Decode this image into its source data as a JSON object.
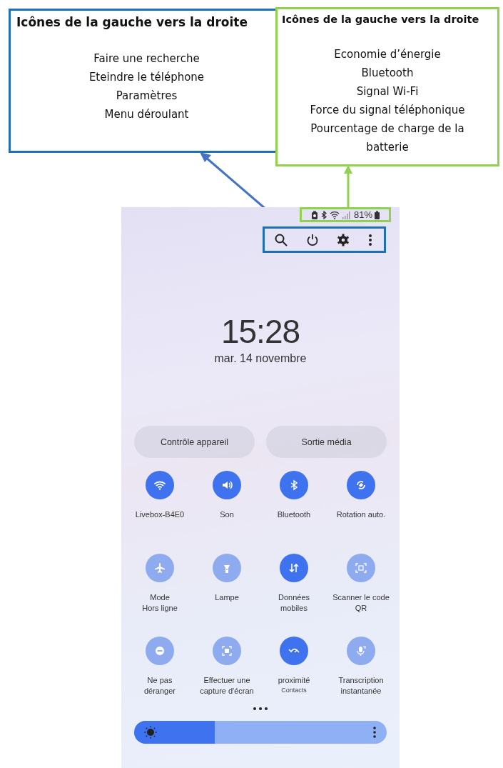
{
  "callouts": [
    {
      "title": "Icônes de la gauche vers la droite",
      "color": "#1f6fb5",
      "lines": [
        "Faire une recherche",
        "Eteindre le téléphone",
        "Paramètres",
        "Menu déroulant"
      ]
    },
    {
      "title": "Icônes de la gauche vers la droite",
      "color": "#92d050",
      "lines": [
        "Economie d’énergie",
        "Bluetooth",
        "Signal Wi-Fi",
        "Force du signal téléphonique",
        "Pourcentage de charge de la batterie"
      ]
    }
  ],
  "phone": {
    "status_bar": {
      "battery": "81%"
    },
    "clock": "15:28",
    "date": "mar. 14 novembre",
    "buttons": [
      "Contrôle appareil",
      "Sortie média"
    ],
    "tiles": [
      {
        "label": "Livebox-B4E0",
        "on": true
      },
      {
        "label": "Son",
        "on": true
      },
      {
        "label": "Bluetooth",
        "on": true
      },
      {
        "label": "Rotation auto.",
        "on": true
      },
      {
        "label": "Mode\nHors ligne",
        "on": false
      },
      {
        "label": "Lampe",
        "on": false
      },
      {
        "label": "Données\nmobiles",
        "on": true
      },
      {
        "label": "Scanner le code\nQR",
        "on": false
      },
      {
        "label": "Ne pas\ndéranger",
        "on": false
      },
      {
        "label": "Effectuer une\ncapture d'écran",
        "on": false
      },
      {
        "label": "proximité",
        "sublabel": "Contacts",
        "on": true
      },
      {
        "label": "Transcription\ninstantanée",
        "on": false
      }
    ],
    "brightness": {
      "level": 0.32
    }
  }
}
